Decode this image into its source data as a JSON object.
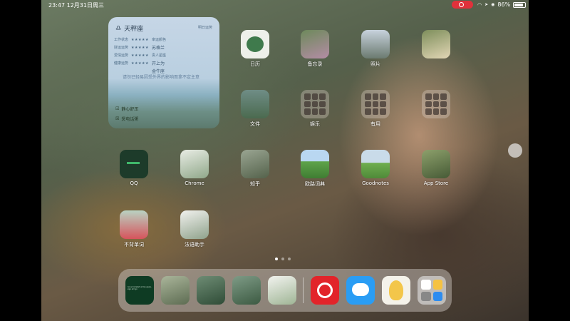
{
  "status": {
    "time": "23:47",
    "date": "12月31日周三",
    "battery": "86%",
    "battery_level": 0.86
  },
  "widget": {
    "title": "天秤座",
    "detail": "明日运势",
    "rows": [
      {
        "label": "工作状态",
        "stars": "★★★★★",
        "key": "幸运颜色",
        "value": ""
      },
      {
        "label": "财运运势",
        "stars": "★★★★★",
        "key": "",
        "value": "苏格兰"
      },
      {
        "label": "爱情运势",
        "stars": "★★★★★",
        "key": "贵人星座",
        "value": ""
      },
      {
        "label": "健康运势",
        "stars": "★★★★★",
        "key": "",
        "value": "开上为"
      },
      {
        "label": "",
        "stars": "",
        "key": "",
        "value": "金牛座"
      }
    ],
    "note": "请勿已轻易因受外界的影响而拿不定主意",
    "items": [
      "静心舒压",
      "煲电话粥"
    ]
  },
  "apps": [
    {
      "label": "日历"
    },
    {
      "label": "备忘录"
    },
    {
      "label": "照片"
    },
    {
      "label": ""
    },
    {
      "label": "文件"
    },
    {
      "label": "娱乐"
    },
    {
      "label": "有用"
    },
    {
      "label": ""
    },
    {
      "label": "QQ"
    },
    {
      "label": "Chrome"
    },
    {
      "label": "知乎"
    },
    {
      "label": "欧路词典"
    },
    {
      "label": "Goodnotes"
    },
    {
      "label": "App Store"
    },
    {
      "label": "不背单词"
    },
    {
      "label": "法语助手"
    }
  ],
  "dock_app_text": "Go accomplish all my goals, sign all I go"
}
